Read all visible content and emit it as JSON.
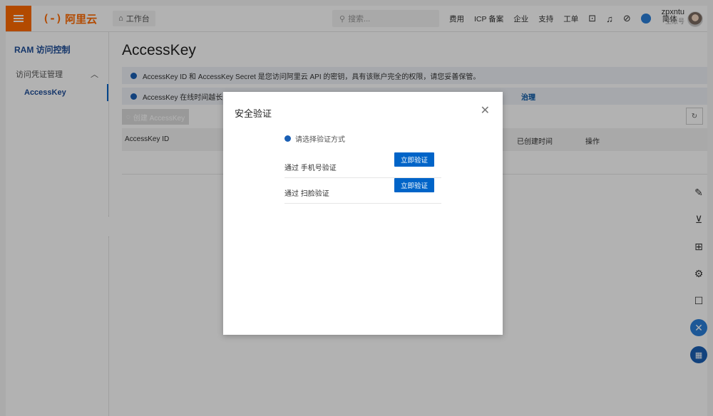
{
  "topbar": {
    "logo_mark": "(-)",
    "logo_text": "阿里云",
    "workbench": "工作台",
    "search_placeholder": "搜索...",
    "links": [
      "费用",
      "ICP 备案",
      "企业",
      "支持",
      "工单"
    ],
    "lang": "简体",
    "user_name": "zpxntu",
    "user_role": "主账号"
  },
  "sidebar": {
    "title": "RAM 访问控制",
    "group": "访问凭证管理",
    "item": "AccessKey"
  },
  "main": {
    "title": "AccessKey",
    "notice1": "AccessKey ID 和 AccessKey Secret 是您访问阿里云 API 的密钥，具有该账户完全的权限，请您妥善保管。",
    "notice2": "AccessKey 在线时间越长，泄露",
    "notice2_tail": "治理",
    "create_button": "创建 AccessKey",
    "columns": [
      "AccessKey ID",
      "已创建时间",
      "操作"
    ]
  },
  "modal": {
    "title": "安全验证",
    "hint": "请选择验证方式",
    "options": [
      {
        "label": "通过 手机号验证",
        "button": "立即验证"
      },
      {
        "label": "通过 扫脸验证",
        "button": "立即验证"
      }
    ]
  },
  "colors": {
    "accent": "#ff6a00",
    "primary": "#0064c8"
  }
}
